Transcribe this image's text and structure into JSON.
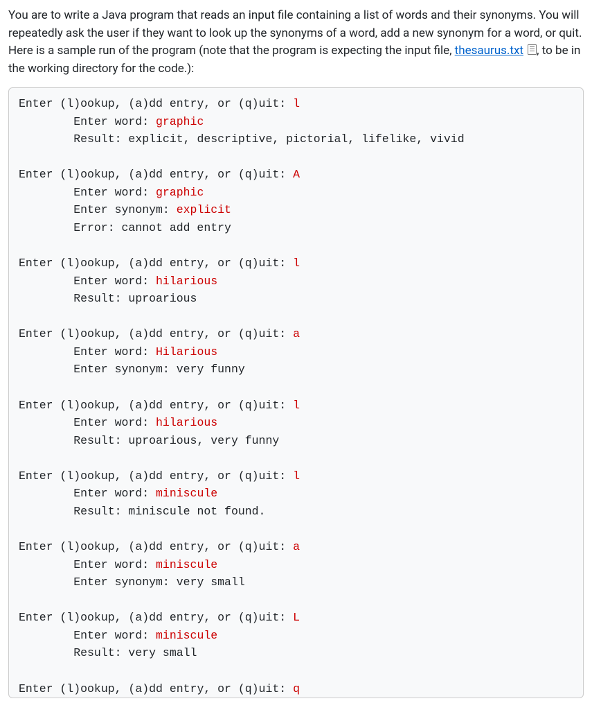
{
  "intro": {
    "t1": "You are to write a Java program that reads an input file containing a list of words and their synonyms. You will repeatedly ask the user if they want to look up the synonyms of a word, add a new synonym for a word, or quit. Here is a sample run of the program (note that the program is expecting the input file, ",
    "file": "thesaurus.txt",
    "t2": ", to be in the working directory for the code.):"
  },
  "prompts": {
    "main": "Enter (l)ookup, (a)dd entry, or (q)uit: ",
    "word": "Enter word: ",
    "syn": "Enter synonym: ",
    "result": "Result: ",
    "error": "Error: "
  },
  "run": {
    "b1": {
      "cmd": "l",
      "word": "graphic",
      "result": "explicit, descriptive, pictorial, lifelike, vivid"
    },
    "b2": {
      "cmd": "A",
      "word": "graphic",
      "syn": "explicit",
      "err": "cannot add entry"
    },
    "b3": {
      "cmd": "l",
      "word": "hilarious",
      "result": "uproarious"
    },
    "b4": {
      "cmd": "a",
      "word": "Hilarious",
      "syn": "very funny"
    },
    "b5": {
      "cmd": "l",
      "word": "hilarious",
      "result": "uproarious, very funny"
    },
    "b6": {
      "cmd": "l",
      "word": "miniscule",
      "result": "miniscule not found."
    },
    "b7": {
      "cmd": "a",
      "word": "miniscule",
      "syn": "very small"
    },
    "b8": {
      "cmd": "L",
      "word": "miniscule",
      "result": "very small"
    },
    "b9": {
      "cmd": "q"
    }
  }
}
